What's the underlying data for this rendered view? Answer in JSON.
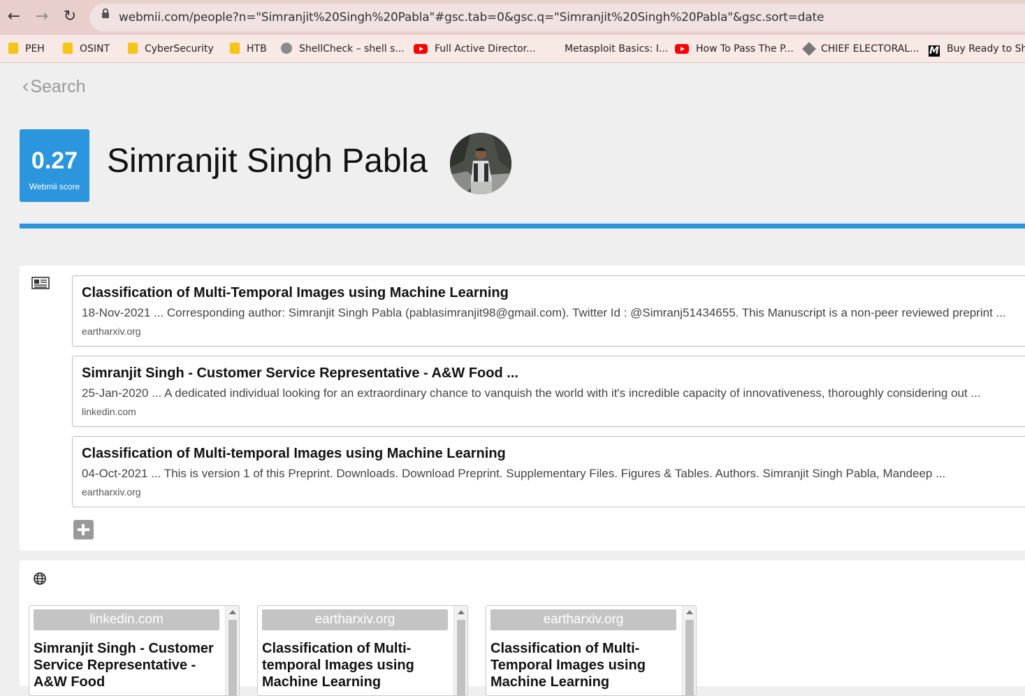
{
  "browser": {
    "url": "webmii.com/people?n=\"Simranjit%20Singh%20Pabla\"#gsc.tab=0&gsc.q=\"Simranjit%20Singh%20Pabla\"&gsc.sort=date",
    "back_icon": "←",
    "forward_icon": "→",
    "reload_icon": "↻",
    "bookmarks": [
      {
        "label": "PEH",
        "icon": "folder-icon"
      },
      {
        "label": "OSINT",
        "icon": "folder-icon"
      },
      {
        "label": "CyberSecurity",
        "icon": "folder-icon"
      },
      {
        "label": "HTB",
        "icon": "folder-icon"
      },
      {
        "label": "ShellCheck – shell s...",
        "icon": "shellcheck-icon"
      },
      {
        "label": "Full Active Director...",
        "icon": "youtube-icon"
      },
      {
        "label": "Metasploit Basics: I...",
        "icon": ""
      },
      {
        "label": "How To Pass The P...",
        "icon": "youtube-icon"
      },
      {
        "label": "CHIEF ELECTORAL...",
        "icon": "diamond-icon"
      },
      {
        "label": "Buy Ready to Sh",
        "icon": "m-icon"
      }
    ]
  },
  "page": {
    "back_label": "Search",
    "back_chevron": "‹",
    "score_value": "0.27",
    "score_label": "Webmii score",
    "person_name": "Simranjit Singh Pabla"
  },
  "news": {
    "results": [
      {
        "title": "Classification of Multi-Temporal Images using Machine Learning",
        "snippet": "18-Nov-2021 ... Corresponding author: Simranjit Singh Pabla (pablasimranjit98@gmail.com). Twitter Id : @Simranj51434655. This Manuscript is a non-peer reviewed preprint ...",
        "domain": "eartharxiv.org"
      },
      {
        "title": "Simranjit Singh - Customer Service Representative - A&W Food ...",
        "snippet": "25-Jan-2020 ... A dedicated individual looking for an extraordinary chance to vanquish the world with it's incredible capacity of innovativeness, thoroughly considering out ...",
        "domain": "linkedin.com"
      },
      {
        "title": "Classification of Multi-temporal Images using Machine Learning",
        "snippet": "04-Oct-2021 ... This is version 1 of this Preprint. Downloads. Download Preprint. Supplementary Files. Figures & Tables. Authors. Simranjit Singh Pabla, Mandeep ...",
        "domain": "eartharxiv.org"
      }
    ]
  },
  "web": {
    "cards": [
      {
        "domain": "linkedin.com",
        "title": "Simranjit Singh - Customer Service Representative - A&W Food"
      },
      {
        "domain": "eartharxiv.org",
        "title": "Classification of Multi-temporal Images using Machine Learning"
      },
      {
        "domain": "eartharxiv.org",
        "title": "Classification of Multi-Temporal Images using Machine Learning"
      }
    ]
  },
  "colors": {
    "accent": "#2b95dd",
    "chrome": "#e8cfcc"
  }
}
